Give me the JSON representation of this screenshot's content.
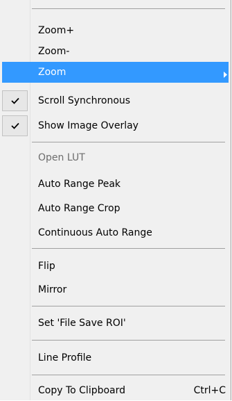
{
  "menu": {
    "items": [
      {
        "label": "Zoom+"
      },
      {
        "label": "Zoom-"
      },
      {
        "label": "Zoom",
        "highlighted": true,
        "icon": "submenu-arrow-icon"
      },
      {
        "label": "Scroll Synchronous",
        "checked": true,
        "icon": "checkmark-icon"
      },
      {
        "label": "Show Image Overlay",
        "checked": true,
        "icon": "checkmark-icon"
      },
      {
        "label": "Open LUT",
        "disabled": true
      },
      {
        "label": "Auto Range Peak"
      },
      {
        "label": "Auto Range Crop"
      },
      {
        "label": "Continuous Auto Range"
      },
      {
        "label": "Flip"
      },
      {
        "label": "Mirror"
      },
      {
        "label": "Set 'File Save ROI'"
      },
      {
        "label": "Line Profile"
      },
      {
        "label": "Copy To Clipboard",
        "shortcut": "Ctrl+C"
      }
    ]
  },
  "colors": {
    "menu_background": "#f0f0f0",
    "highlight": "#3399ff",
    "highlight_text": "#ffffff",
    "disabled_text": "#6d6d6d",
    "separator": "#a0a0a0"
  }
}
